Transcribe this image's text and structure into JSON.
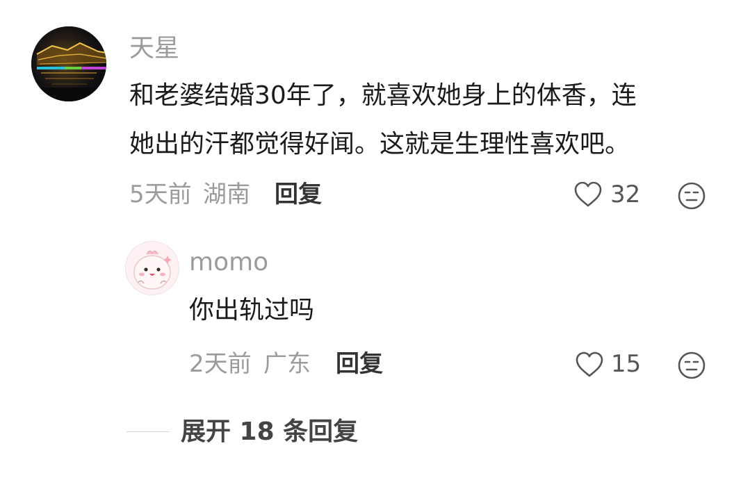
{
  "comment": {
    "username": "天星",
    "text_line1": "和老婆结婚30年了，就喜欢她身上的体香，连",
    "text_line2": "她出的汗都觉得好闻。这就是生理性喜欢吧。",
    "time": "5天前",
    "location": "湖南",
    "reply_label": "回复",
    "likes": "32",
    "avatar_icon": "night-bridge-photo",
    "like_icon": "heart-icon",
    "dislike_icon": "meh-face-icon"
  },
  "reply": {
    "username": "momo",
    "text": "你出轨过吗",
    "time": "2天前",
    "location": "广东",
    "reply_label": "回复",
    "likes": "15",
    "avatar_icon": "pink-cartoon-avatar",
    "like_icon": "heart-icon",
    "dislike_icon": "meh-face-icon"
  },
  "expand": {
    "label": "展开 18 条回复"
  },
  "colors": {
    "muted": "#9b9b9b",
    "text": "#1a1a1a",
    "action": "#333333"
  }
}
